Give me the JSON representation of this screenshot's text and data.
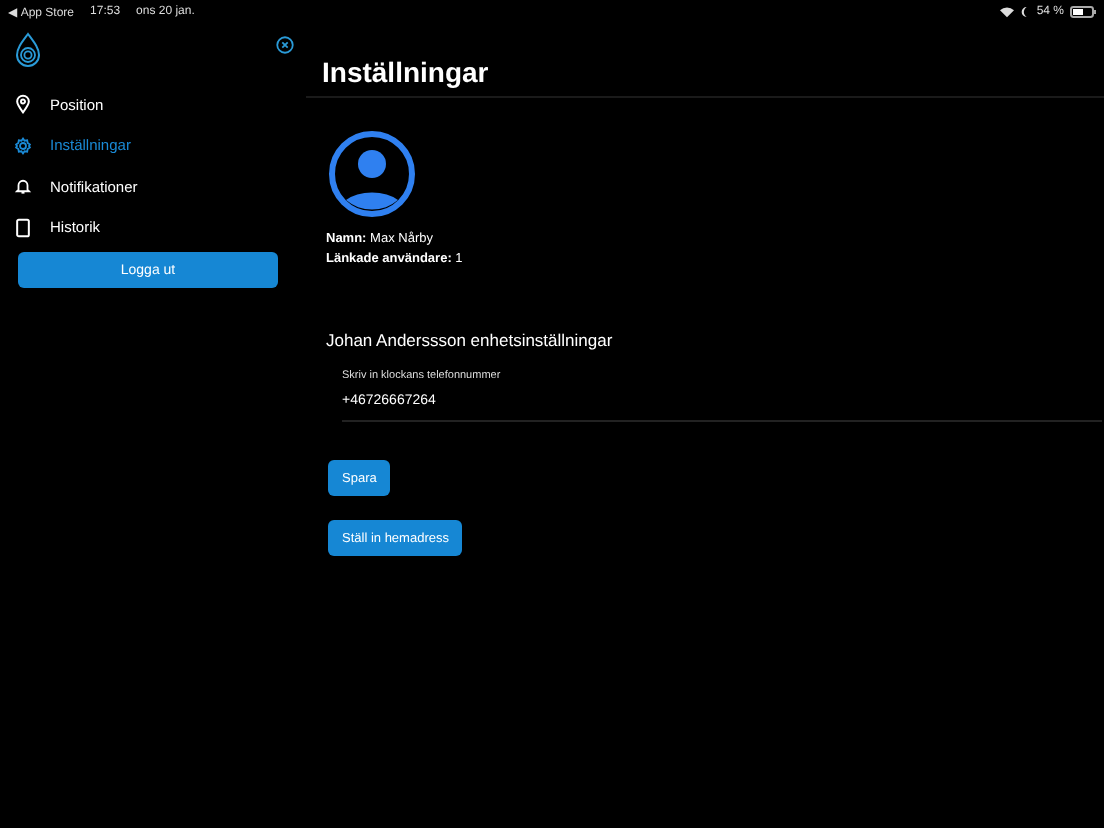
{
  "status_bar": {
    "back": "◀ App Store",
    "time": "17:53",
    "date": "ons 20 jan.",
    "battery": "54 %"
  },
  "sidebar": {
    "items": [
      {
        "label": "Position",
        "selected": false
      },
      {
        "label": "Inställningar",
        "selected": true
      },
      {
        "label": "Notifikationer",
        "selected": false
      },
      {
        "label": "Historik",
        "selected": false
      }
    ],
    "logout": "Logga ut"
  },
  "page": {
    "title": "Inställningar",
    "profile": [
      {
        "label": "Namn:",
        "value": "Max Nårby"
      },
      {
        "label": "Länkade användare:",
        "value": "1"
      }
    ],
    "section_title": "Johan Anderssson enhetsinställningar",
    "phone_field": {
      "label": "Skriv in klockans telefonnummer",
      "value": "+46726667264"
    },
    "buttons": [
      "Spara",
      "Ställ in hemadress"
    ]
  }
}
